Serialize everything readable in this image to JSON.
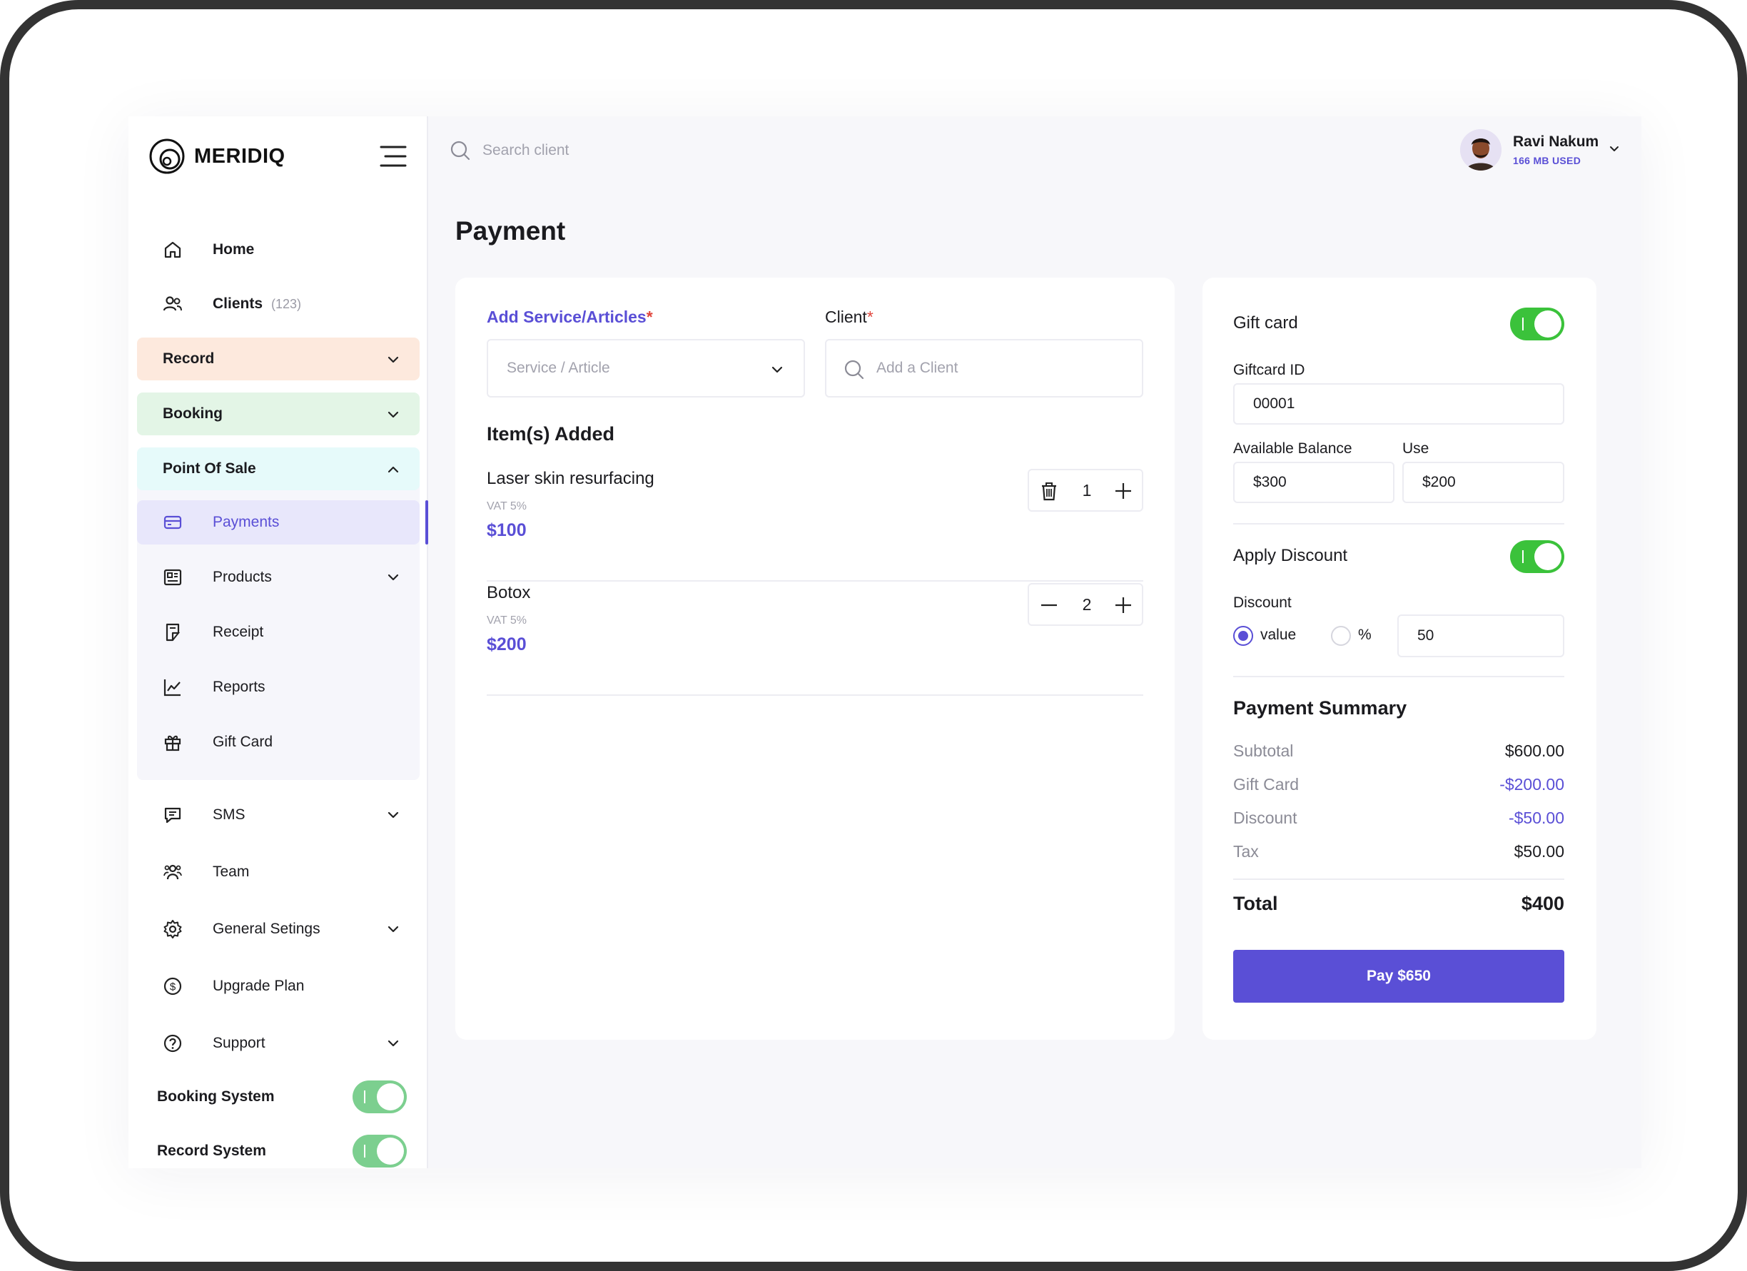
{
  "brand": {
    "name": "MERIDIQ"
  },
  "search": {
    "placeholder": "Search client"
  },
  "user": {
    "name": "Ravi Nakum",
    "usage": "166 MB USED"
  },
  "sidebar": {
    "home": "Home",
    "clients": {
      "label": "Clients",
      "count": "(123)"
    },
    "record": "Record",
    "booking": "Booking",
    "point_of_sale": "Point Of Sale",
    "pos_items": [
      "Payments",
      "Products",
      "Receipt",
      "Reports",
      "Gift Card"
    ],
    "sms": "SMS",
    "team": "Team",
    "general_settings": "General Setings",
    "upgrade_plan": "Upgrade Plan",
    "support": "Support",
    "booking_system": "Booking System",
    "record_system": "Record System"
  },
  "page": {
    "title": "Payment"
  },
  "form": {
    "service_label": "Add Service/Articles",
    "service_placeholder": "Service / Article",
    "client_label": "Client",
    "client_placeholder": "Add a Client",
    "required_mark": "*"
  },
  "items_title": "Item(s) Added",
  "items": [
    {
      "name": "Laser skin resurfacing",
      "vat": "VAT 5%",
      "price": "$100",
      "qty": "1"
    },
    {
      "name": "Botox",
      "vat": "VAT 5%",
      "price": "$200",
      "qty": "2"
    }
  ],
  "giftcard": {
    "title": "Gift card",
    "id_label": "Giftcard ID",
    "id_value": "00001",
    "balance_label": "Available Balance",
    "balance_value": "$300",
    "use_label": "Use",
    "use_value": "$200"
  },
  "discount": {
    "title": "Apply Discount",
    "label": "Discount",
    "opt_value": "value",
    "opt_percent": "%",
    "amount": "50"
  },
  "summary": {
    "title": "Payment Summary",
    "rows": [
      {
        "label": "Subtotal",
        "value": "$600.00"
      },
      {
        "label": "Gift Card",
        "value": "-$200.00"
      },
      {
        "label": "Discount",
        "value": "-$50.00"
      },
      {
        "label": "Tax",
        "value": "$50.00"
      }
    ],
    "total_label": "Total",
    "total_value": "$400",
    "pay_button": "Pay $650"
  },
  "colors": {
    "accent": "#5a4fd6",
    "toggle_on": "#3bc23b",
    "record_bg": "#fde9dd",
    "booking_bg": "#e3f5e6",
    "pos_bg": "#e6fafa"
  }
}
